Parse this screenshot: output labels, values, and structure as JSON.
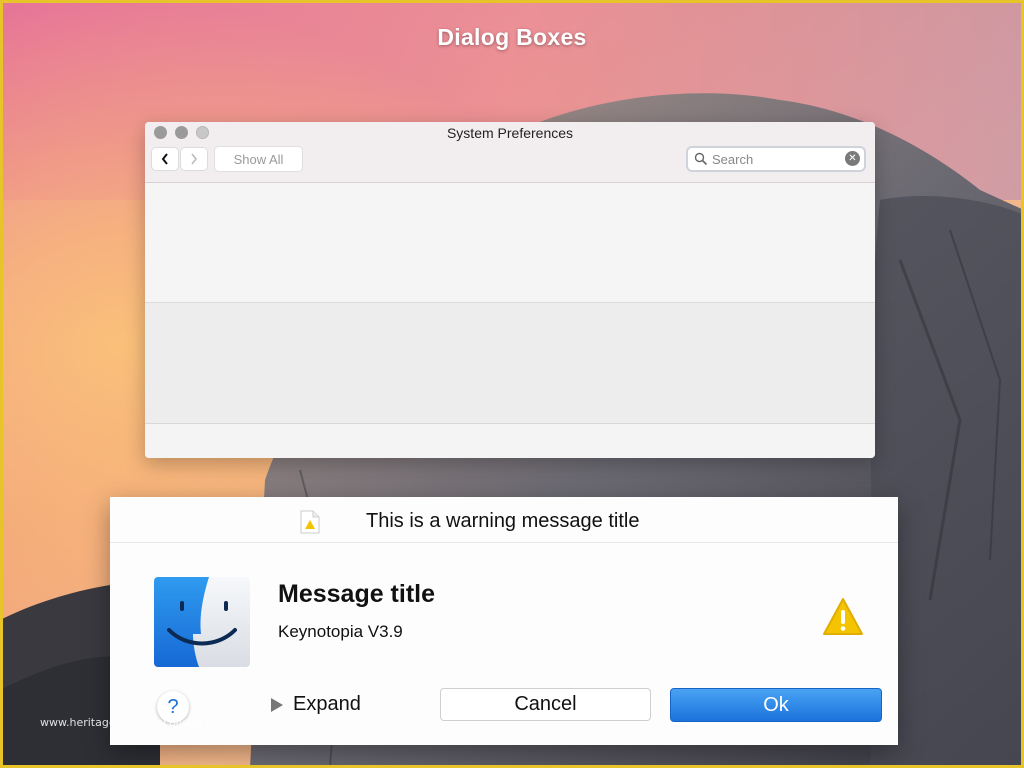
{
  "slide": {
    "title": "Dialog Boxes"
  },
  "prefs_window": {
    "title": "System Preferences",
    "show_all_label": "Show All",
    "search_placeholder": "Search"
  },
  "alert": {
    "header_title": "This is a warning message title",
    "message_title": "Message title",
    "message_subtitle": "Keynotopia V3.9",
    "help_label": "?",
    "expand_label": "Expand",
    "cancel_label": "Cancel",
    "ok_label": "Ok"
  },
  "watermark": "www.heritagechristiancollege.com",
  "icons": {
    "back": "chevron-left-icon",
    "forward": "chevron-right-icon",
    "search": "search-icon",
    "clear": "clear-icon",
    "document": "warning-document-icon",
    "finder": "finder-icon",
    "warning": "warning-icon"
  },
  "colors": {
    "frame": "#e6c42a",
    "ok_button": "#1a73dc",
    "warning": "#f5c400"
  }
}
